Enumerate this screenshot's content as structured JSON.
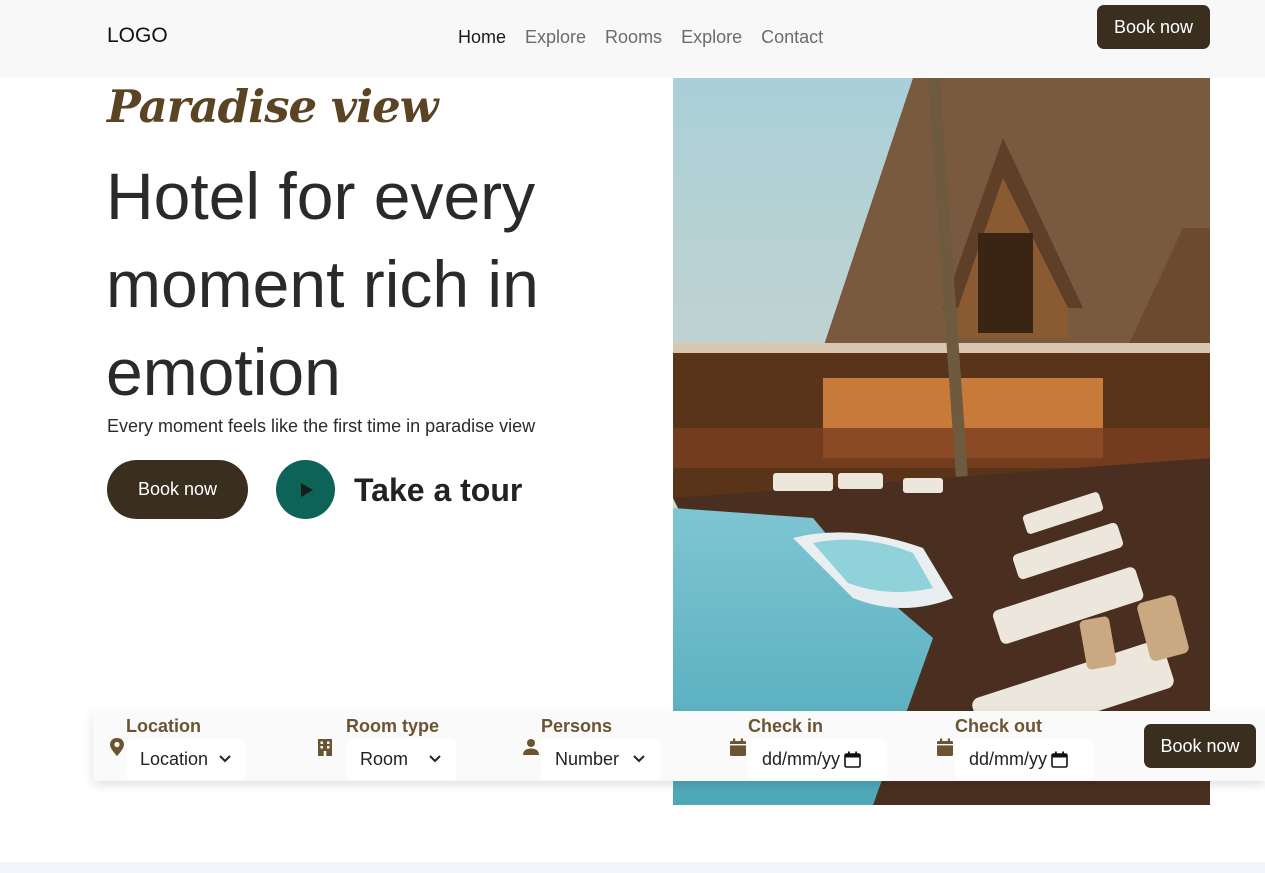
{
  "nav": {
    "logo": "LOGO",
    "links": [
      {
        "label": "Home",
        "active": true
      },
      {
        "label": "Explore",
        "active": false
      },
      {
        "label": "Rooms",
        "active": false
      },
      {
        "label": "Explore",
        "active": false
      },
      {
        "label": "Contact",
        "active": false
      }
    ],
    "cta": "Book now"
  },
  "hero": {
    "tagline": "Paradise view",
    "headline": "Hotel for every moment rich in emotion",
    "subtitle": "Every moment feels like the first time in paradise view",
    "book_label": "Book now",
    "tour_label": "Take a tour",
    "image_icon": "hotel-pool-photo"
  },
  "booking": {
    "location": {
      "label": "Location",
      "value": "Location",
      "icon": "map-pin-icon"
    },
    "room_type": {
      "label": "Room type",
      "value": "Room",
      "icon": "building-icon"
    },
    "persons": {
      "label": "Persons",
      "value": "Number",
      "icon": "person-icon"
    },
    "check_in": {
      "label": "Check in",
      "value": "dd/mm/yy",
      "icon": "calendar-icon"
    },
    "check_out": {
      "label": "Check out",
      "value": "dd/mm/yy",
      "icon": "calendar-icon"
    },
    "submit": "Book now"
  },
  "colors": {
    "brand_dark": "#3a2f1f",
    "accent_teal": "#0e6358",
    "label_brown": "#6b5431"
  }
}
